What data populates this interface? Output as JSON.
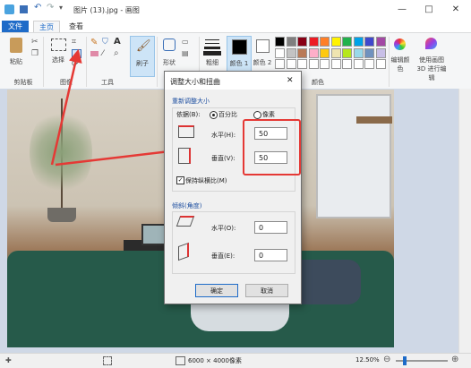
{
  "window": {
    "title": "图片 (13).jpg - 画图",
    "minimize": "—",
    "maximize": "□",
    "close": "✕"
  },
  "tabs": [
    {
      "label": "文件"
    },
    {
      "label": "主页"
    },
    {
      "label": "查看"
    }
  ],
  "ribbon": {
    "paste": "粘贴",
    "clipboard_group": "剪贴板",
    "select": "选择",
    "image_group": "图像",
    "tools_group": "工具",
    "brush": "刷子",
    "shapes": "形状",
    "outline": "粗细",
    "color1": "颜色 1",
    "color2": "颜色 2",
    "colors_group": "颜色",
    "edit_colors": "编辑颜色",
    "paint3d": "使用画图 3D 进行编辑"
  },
  "palette": [
    "#000000",
    "#7f7f7f",
    "#880015",
    "#ed1c24",
    "#ff7f27",
    "#fff200",
    "#22b14c",
    "#00a2e8",
    "#3f48cc",
    "#a349a4",
    "#ffffff",
    "#c3c3c3",
    "#b97a57",
    "#ffaec9",
    "#ffc90e",
    "#efe4b0",
    "#b5e61d",
    "#99d9ea",
    "#7092be",
    "#c8bfe7"
  ],
  "dialog": {
    "title": "调整大小和扭曲",
    "close": "✕",
    "resize_group": "重新调整大小",
    "by_label": "依据(B):",
    "percent_label": "百分比",
    "pixels_label": "像素",
    "horizontal_label": "水平(H):",
    "horizontal_value": "50",
    "vertical_label": "垂直(V):",
    "vertical_value": "50",
    "keep_ratio_label": "保持纵横比(M)",
    "skew_group": "倾斜(角度)",
    "skew_h_label": "水平(O):",
    "skew_h_value": "0",
    "skew_v_label": "垂直(E):",
    "skew_v_value": "0",
    "ok": "确定",
    "cancel": "取消"
  },
  "status": {
    "dimensions": "6000 × 4000像素",
    "zoom": "12.50%",
    "zoom_fraction": 0.125
  }
}
